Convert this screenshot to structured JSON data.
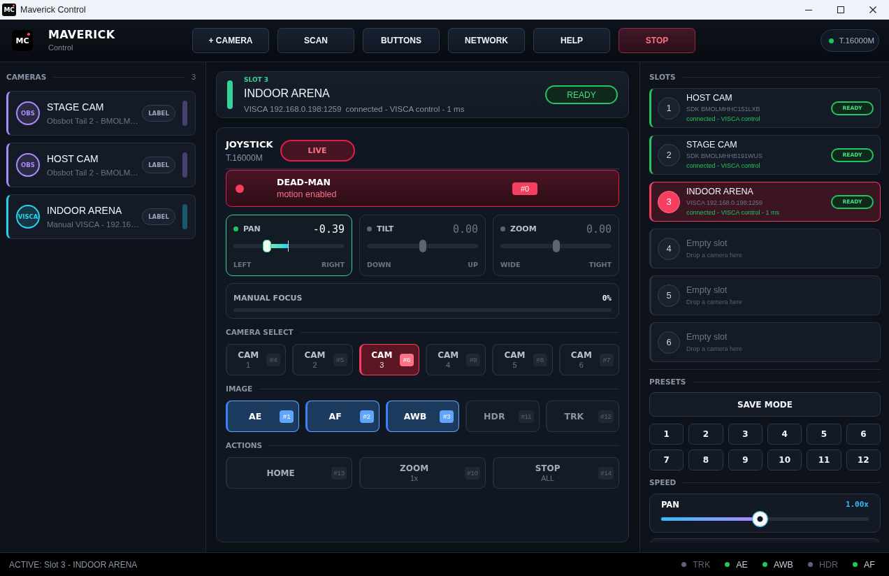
{
  "window": {
    "title": "Maverick Control",
    "icon_text": "MC"
  },
  "header": {
    "logo": "MC",
    "brand": "MAVERICK",
    "tagline": "Control",
    "buttons": [
      {
        "label": "+ CAMERA",
        "kind": "normal"
      },
      {
        "label": "SCAN",
        "kind": "normal"
      },
      {
        "label": "BUTTONS",
        "kind": "normal"
      },
      {
        "label": "NETWORK",
        "kind": "normal"
      },
      {
        "label": "HELP",
        "kind": "normal"
      },
      {
        "label": "STOP",
        "kind": "danger"
      }
    ],
    "device": {
      "label": "T.16000M",
      "connected": true
    }
  },
  "cameras": {
    "title": "CAMERAS",
    "count": "3",
    "items": [
      {
        "name": "STAGE CAM",
        "detail": "Obsbot Tail 2 - BMOLM…",
        "badge": "OBS",
        "button": "LABEL",
        "color": "#a78bfa"
      },
      {
        "name": "HOST CAM",
        "detail": "Obsbot Tail 2 - BMOLM…",
        "badge": "OBS",
        "button": "LABEL",
        "color": "#a78bfa"
      },
      {
        "name": "INDOOR ARENA",
        "detail": "Manual VISCA - 192.16…",
        "badge": "VISCA",
        "button": "LABEL",
        "color": "#22d3ee"
      }
    ]
  },
  "active_slot": {
    "slot": "SLOT 3",
    "name": "INDOOR ARENA",
    "address": "VISCA 192.168.0.198:1259",
    "status": "connected - VISCA control - 1 ms",
    "badge": "READY",
    "ready": true
  },
  "joystick": {
    "title": "JOYSTICK",
    "device": "T.16000M",
    "live": {
      "label": "LIVE",
      "on": true
    },
    "deadman": {
      "title": "DEAD-MAN",
      "status": "motion enabled",
      "key": "#0",
      "engaged": true
    },
    "axes": [
      {
        "name": "PAN",
        "value": "-0.39",
        "active": true,
        "level": 0.305,
        "low": "LEFT",
        "high": "RIGHT"
      },
      {
        "name": "TILT",
        "value": "0.00",
        "active": false,
        "level": 0.5,
        "low": "DOWN",
        "high": "UP"
      },
      {
        "name": "ZOOM",
        "value": "0.00",
        "active": false,
        "level": 0.5,
        "low": "WIDE",
        "high": "TIGHT"
      }
    ],
    "focus": {
      "label": "MANUAL FOCUS",
      "reading": "0%",
      "level": 0
    },
    "camera_select": {
      "title": "CAMERA SELECT",
      "items": [
        {
          "label": "CAM",
          "number": "1",
          "key": "#4",
          "selected": false
        },
        {
          "label": "CAM",
          "number": "2",
          "key": "#5",
          "selected": false
        },
        {
          "label": "CAM",
          "number": "3",
          "key": "#6",
          "selected": true
        },
        {
          "label": "CAM",
          "number": "4",
          "key": "#9",
          "selected": false
        },
        {
          "label": "CAM",
          "number": "5",
          "key": "#8",
          "selected": false
        },
        {
          "label": "CAM",
          "number": "6",
          "key": "#7",
          "selected": false
        }
      ]
    },
    "image": {
      "title": "IMAGE",
      "items": [
        {
          "label": "AE",
          "key": "#1",
          "on": true
        },
        {
          "label": "AF",
          "key": "#2",
          "on": true
        },
        {
          "label": "AWB",
          "key": "#3",
          "on": true
        },
        {
          "label": "HDR",
          "key": "#11",
          "on": false
        },
        {
          "label": "TRK",
          "key": "#12",
          "on": false
        }
      ]
    },
    "actions": {
      "title": "ACTIONS",
      "items": [
        {
          "label": "HOME",
          "key": "#13"
        },
        {
          "label": "ZOOM",
          "sub": "1x",
          "key": "#10"
        },
        {
          "label": "STOP",
          "sub": "ALL",
          "key": "#14"
        }
      ]
    }
  },
  "slots": {
    "title": "SLOTS",
    "items": [
      {
        "number": "1",
        "kind": "camera",
        "name": "HOST CAM",
        "detail": "SDK BMOLMHHC151LXB",
        "status": "connected - VISCA control",
        "badge": "READY",
        "selected": false
      },
      {
        "number": "2",
        "kind": "camera",
        "name": "STAGE CAM",
        "detail": "SDK BMOLMHHB191WUS",
        "status": "connected - VISCA control",
        "badge": "READY",
        "selected": false
      },
      {
        "number": "3",
        "kind": "camera",
        "name": "INDOOR ARENA",
        "detail": "VISCA 192.168.0.198:1259",
        "status": "connected - VISCA control - 1 ms",
        "badge": "READY",
        "selected": true
      },
      {
        "number": "4",
        "kind": "empty",
        "name": "Empty slot",
        "detail": "Drop a camera here",
        "selected": false
      },
      {
        "number": "5",
        "kind": "empty",
        "name": "Empty slot",
        "detail": "Drop a camera here",
        "selected": false
      },
      {
        "number": "6",
        "kind": "empty",
        "name": "Empty slot",
        "detail": "Drop a camera here",
        "selected": false
      }
    ]
  },
  "presets": {
    "title": "PRESETS",
    "save": "SAVE MODE",
    "buttons": [
      "1",
      "2",
      "3",
      "4",
      "5",
      "6",
      "7",
      "8",
      "9",
      "10",
      "11",
      "12"
    ]
  },
  "speed": {
    "title": "SPEED",
    "items": [
      {
        "label": "PAN",
        "reading": "1.00x",
        "level": 0.475
      }
    ]
  },
  "status_bar": {
    "active": "ACTIVE: Slot 3 - INDOOR ARENA",
    "indicators": [
      {
        "label": "TRK",
        "on": false
      },
      {
        "label": "AE",
        "on": true
      },
      {
        "label": "AWB",
        "on": true
      },
      {
        "label": "HDR",
        "on": false
      },
      {
        "label": "AF",
        "on": true
      }
    ]
  }
}
